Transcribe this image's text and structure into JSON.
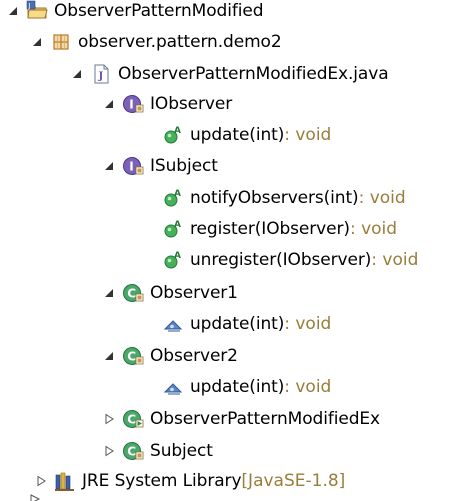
{
  "tree": {
    "project": {
      "label": "ObserverPatternModified"
    },
    "package": {
      "label": "observer.pattern.demo2"
    },
    "file": {
      "label": "ObserverPatternModifiedEx.java"
    },
    "iobserver": {
      "label": "IObserver",
      "methods": [
        {
          "name": "update(int)",
          "suffix": " : void"
        }
      ]
    },
    "isubject": {
      "label": "ISubject",
      "methods": [
        {
          "name": "notifyObservers(int)",
          "suffix": " : void"
        },
        {
          "name": "register(IObserver)",
          "suffix": " : void"
        },
        {
          "name": "unregister(IObserver)",
          "suffix": " : void"
        }
      ]
    },
    "observer1": {
      "label": "Observer1",
      "methods": [
        {
          "name": "update(int)",
          "suffix": " : void"
        }
      ]
    },
    "observer2": {
      "label": "Observer2",
      "methods": [
        {
          "name": "update(int)",
          "suffix": " : void"
        }
      ]
    },
    "main_class": {
      "label": "ObserverPatternModifiedEx"
    },
    "subject": {
      "label": "Subject"
    },
    "jre": {
      "label": "JRE System Library",
      "suffix": " [JavaSE-1.8]"
    }
  },
  "colors": {
    "interface": "#6a4fa8",
    "class": "#3f9a5d",
    "method_public": "#3aa34f",
    "method_default": "#3b6db5",
    "package": "#c58a36",
    "decorator_suffix": "#9a7d3a"
  }
}
